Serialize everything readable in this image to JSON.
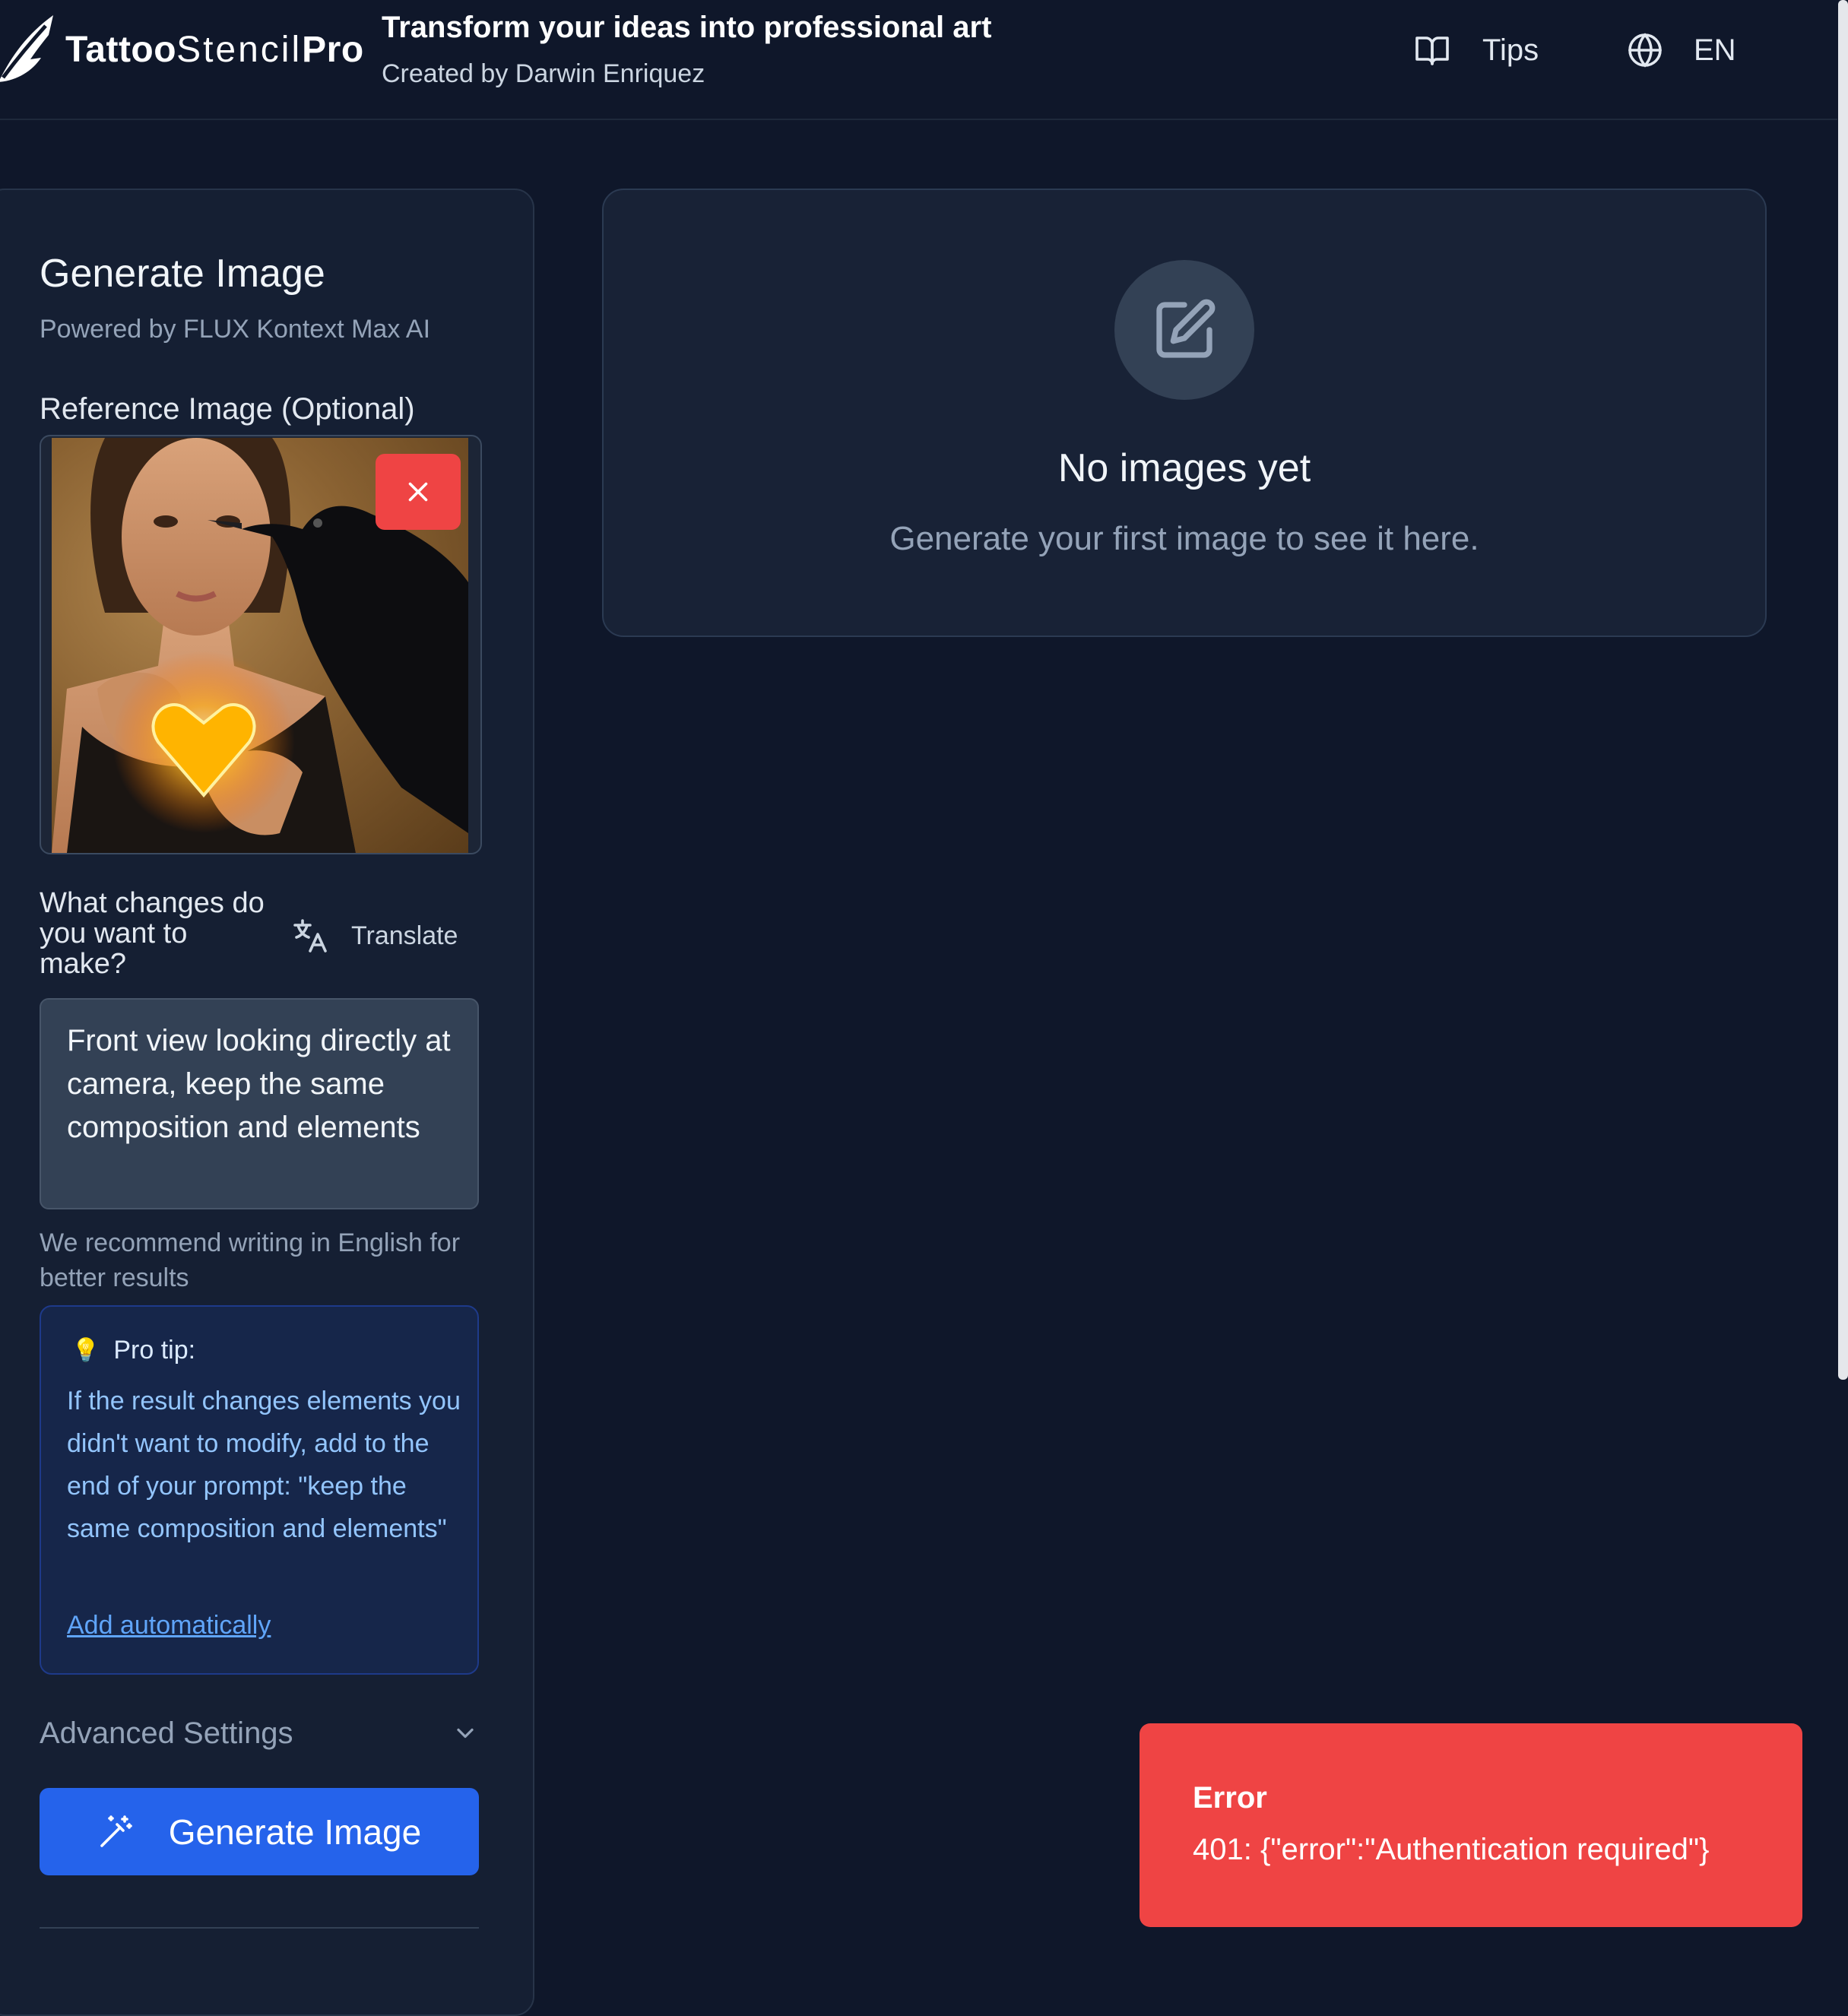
{
  "header": {
    "logo": {
      "part1": "Tattoo",
      "part2": "Stencil",
      "part3": "Pro"
    },
    "title": "Transform your ideas into professional art",
    "subtitle": "Created by Darwin Enriquez",
    "tips_label": "Tips",
    "tips_icon": "book-open-icon",
    "lang_label": "EN",
    "lang_icon": "globe-icon"
  },
  "sidebar": {
    "title": "Generate Image",
    "subtitle": "Powered by FLUX Kontext Max AI",
    "reference_label": "Reference Image (Optional)",
    "changes_label": "What changes do you want to make?",
    "translate_label": "Translate",
    "prompt_value": "Front view looking directly at camera, keep the same composition and elements",
    "recommend_text": "We recommend writing in English for better results",
    "tip": {
      "icon": "💡",
      "heading": "Pro tip:",
      "text": "If the result changes elements you didn't want to modify, add to the end of your prompt: \"keep the same composition and elements\"",
      "link": "Add automatically"
    },
    "advanced_label": "Advanced Settings",
    "generate_label": "Generate Image"
  },
  "gallery": {
    "empty_title": "No images yet",
    "empty_subtitle": "Generate your first image to see it here."
  },
  "toast": {
    "title": "Error",
    "message": "401: {\"error\":\"Authentication required\"}"
  },
  "colors": {
    "background": "#0f172a",
    "panel": "#151f33",
    "accent_blue": "#2563eb",
    "error_red": "#ef4444",
    "tip_bg": "#16264a"
  }
}
